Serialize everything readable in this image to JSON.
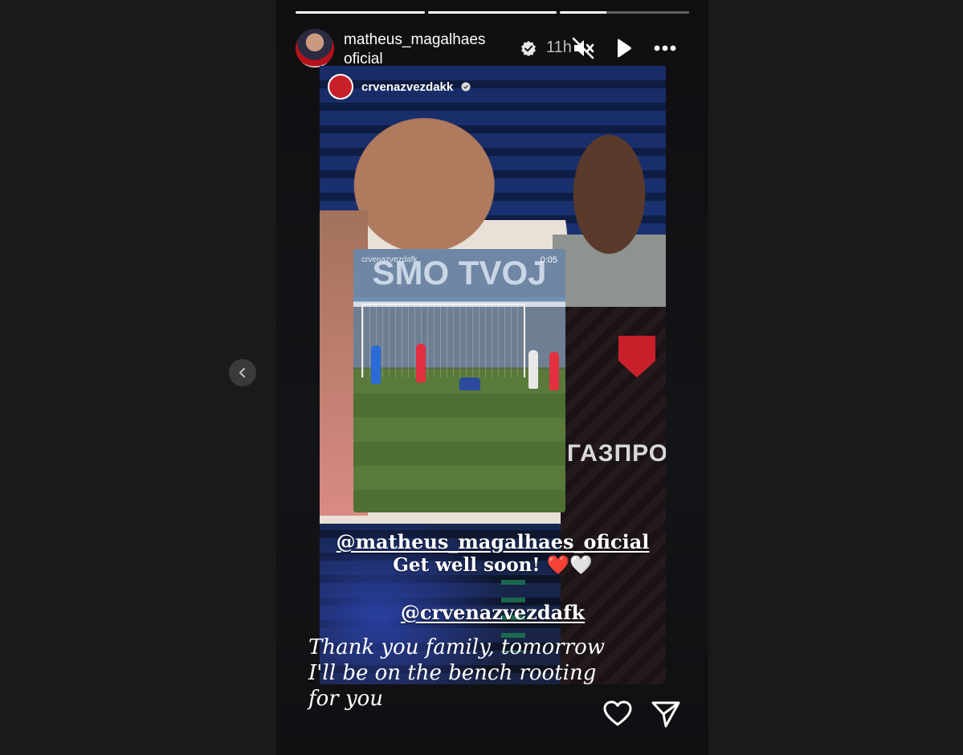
{
  "story": {
    "progress": [
      1,
      1,
      0.36
    ],
    "user": {
      "username": "matheus_magalhaes  oficial",
      "verified": true,
      "time": "11h"
    },
    "controls": {
      "mute_icon": "speaker-muted-icon",
      "play_icon": "play-icon",
      "more_icon": "more-horizontal-icon"
    },
    "repost": {
      "club_name": "crvenazvezdakk",
      "video": {
        "banner": "SMO TVOJ",
        "handle": "crvenazvezdafk",
        "time": "0:05"
      },
      "mention1": "@matheus_magalhaes_oficial",
      "message": "Get well soon! ❤️🤍",
      "mention2": "@crvenazvezdafk",
      "jersey_text": "ГАЗПРОМ"
    },
    "caption_lines": [
      "Thank you family, tomorrow",
      "I'll be on the bench rooting",
      "for you"
    ],
    "actions": {
      "like_icon": "heart-icon",
      "share_icon": "send-icon"
    }
  },
  "nav": {
    "prev_icon": "chevron-left-icon"
  },
  "colors": {
    "brand_red": "#c8202a",
    "background": "#1a1a1a"
  }
}
